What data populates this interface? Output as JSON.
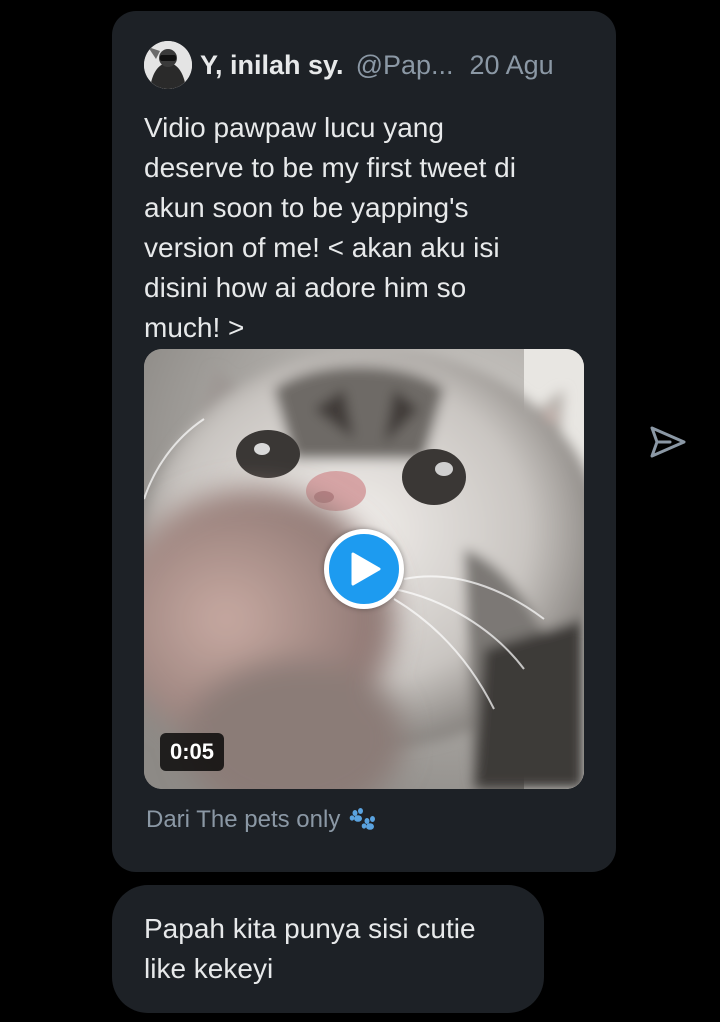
{
  "tweet": {
    "author_name": "Y, inilah sy.",
    "author_handle": "@Pap...",
    "date": "20 Agu",
    "text": "Vidio pawpaw lucu yang\ndeserve to be my first tweet di\nakun soon to be yapping's\nversion of me! < akan aku isi\ndisini how ai adore him so\nmuch! >",
    "video_duration": "0:05",
    "source": "Dari The pets only",
    "icons": {
      "avatar": "profile-photo",
      "play": "play-icon",
      "source": "paw-prints-icon"
    }
  },
  "share": {
    "icon": "send-icon"
  },
  "message": {
    "text": "Papah kita punya sisi cutie\nlike kekeyi"
  },
  "colors": {
    "background": "#000000",
    "bubble": "#1d2126",
    "text": "#e7e9ea",
    "muted": "#8b98a5",
    "accent": "#1d9bf0"
  }
}
